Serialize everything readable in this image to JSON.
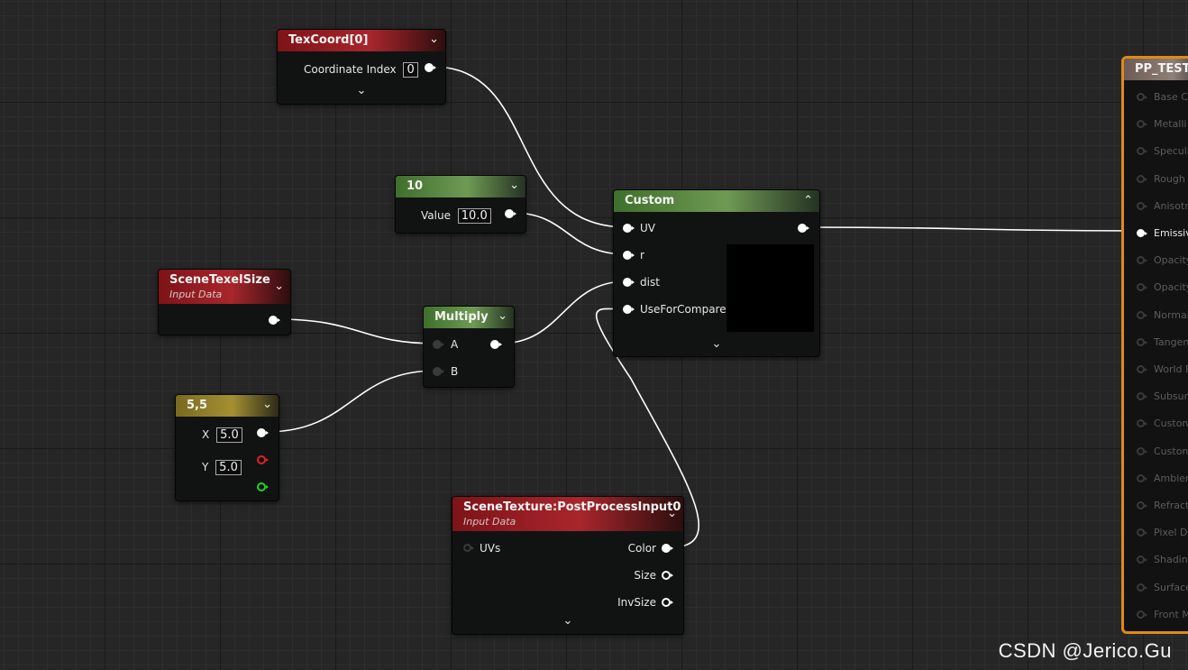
{
  "nodes": {
    "texcoord": {
      "title": "TexCoord[0]",
      "coord_label": "Coordinate Index",
      "coord_value": "0"
    },
    "const10": {
      "title": "10",
      "value_label": "Value",
      "value": "10.0"
    },
    "texelsize": {
      "title": "SceneTexelSize",
      "subtitle": "Input Data"
    },
    "multiply": {
      "title": "Multiply",
      "pin_a": "A",
      "pin_b": "B"
    },
    "vec55": {
      "title": "5,5",
      "x_label": "X",
      "x_value": "5.0",
      "y_label": "Y",
      "y_value": "5.0"
    },
    "custom": {
      "title": "Custom",
      "inputs": [
        "UV",
        "r",
        "dist",
        "UseForCompare"
      ]
    },
    "scenetex": {
      "title": "SceneTexture:PostProcessInput0",
      "subtitle": "Input Data",
      "input": "UVs",
      "outputs": [
        "Color",
        "Size",
        "InvSize"
      ]
    },
    "result": {
      "title": "PP_TEST",
      "pins": [
        "Base C",
        "Metalli",
        "Specula",
        "Rough",
        "Anisotr",
        "Emissiv",
        "Opacity",
        "Opacity",
        "Normal",
        "Tangen",
        "World F",
        "Subsurf",
        "Custon",
        "Custon",
        "Ambien",
        "Refract",
        "Pixel D",
        "Shadin",
        "Surface",
        "Front M"
      ],
      "active_index": 5
    }
  },
  "colors": {
    "wire": "#ffffff",
    "result_border": "#e08a16",
    "pin_red": "#e0202a",
    "pin_green": "#21d32a"
  },
  "icons": {
    "collapse": "chevron-down-icon",
    "expand": "chevron-up-icon"
  },
  "watermark": "CSDN @Jerico.Gu"
}
